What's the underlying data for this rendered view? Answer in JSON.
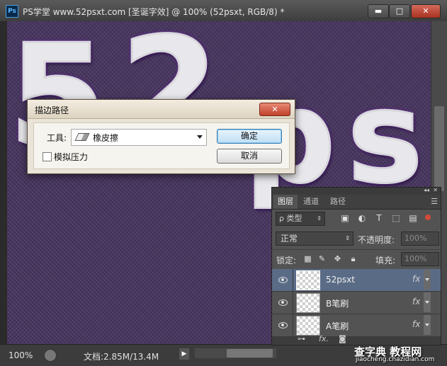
{
  "window": {
    "title": "PS学堂 www.52psxt.com [圣诞字效] @ 100% (52psxt, RGB/8) *",
    "app_icon": "Ps",
    "controls": [
      "minimize-icon",
      "maximize-icon",
      "close-icon"
    ]
  },
  "status": {
    "zoom": "100%",
    "doc_info": "文档:2.85M/13.4M"
  },
  "dialog": {
    "title": "描边路径",
    "tool_label": "工具:",
    "tool_value": "橡皮擦",
    "simulate_pressure_label": "模拟压力",
    "simulate_pressure_checked": false,
    "ok_label": "确定",
    "cancel_label": "取消"
  },
  "layers_panel": {
    "tabs": [
      "图层",
      "通道",
      "路径"
    ],
    "active_tab": "图层",
    "filter_type": "ρ 类型",
    "blend_mode": "正常",
    "opacity_label": "不透明度:",
    "opacity_value": "100%",
    "lock_label": "锁定:",
    "fill_label": "填充:",
    "fill_value": "100%",
    "layers": [
      {
        "name": "52psxt",
        "selected": true,
        "fx": "fx"
      },
      {
        "name": "B笔刷",
        "selected": false,
        "fx": "fx"
      },
      {
        "name": "A笔刷",
        "selected": false,
        "fx": "fx"
      }
    ]
  },
  "watermark": {
    "main": "查字典 教程网",
    "sub": "jiaocheng.chazidian.com"
  }
}
